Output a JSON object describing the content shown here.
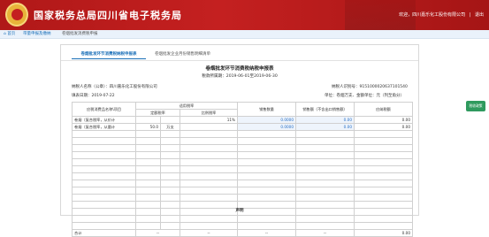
{
  "header": {
    "title": "国家税务总局四川省电子税务局",
    "welcome": "欢迎，四川嘉乐化工股份有限公司",
    "logout": "退出"
  },
  "nav": {
    "home": "首页",
    "crumb1": "带量申报及缴纳",
    "crumb2": "卷烟批发消费税申报"
  },
  "tabs": {
    "active": "卷烟批发环节消费税纳税申报表",
    "inactive": "卷烟批发企业月份销售明细清单"
  },
  "form": {
    "title": "卷烟批发环节消费税纳税申报表",
    "period": "税款所属期：2019-06-01至2019-06-30",
    "taxpayer_label": "纳税人名称（公章）：",
    "taxpayer_name": "四川嘉乐化工股份有限公司",
    "tax_id_label": "纳税人识别号：",
    "tax_id": "9151000020637101540",
    "fill_date_label": "填表日期：",
    "fill_date": "2019-07-22",
    "units": "单位：卷烟万支、金额单位：元（列至角分）"
  },
  "table": {
    "headers": {
      "product": "应税消费品名称\\项目",
      "rate": "适用税率",
      "fixed": "定额税率",
      "percent": "比例税率",
      "quantity": "销售数量",
      "sales": "销售额（不含出口销售额）",
      "tax": "应纳税额"
    },
    "rows": [
      {
        "name": "卷烟（复合税率，从价计",
        "fixed": "",
        "unit": "",
        "percent": "11%",
        "quantity": "0.0000",
        "sales": "0.00",
        "tax": "0.00"
      },
      {
        "name": "卷烟（复合税率，从量计",
        "fixed": "50.0",
        "unit": "万支",
        "percent": "",
        "quantity": "0.0000",
        "sales": "0.00",
        "tax": "0.00"
      }
    ],
    "total_label": "合计",
    "total_fixed": "--",
    "total_percent": "--",
    "total_quantity": "--",
    "total_sales": "--",
    "total_tax": "0.00"
  },
  "declaration": "声明",
  "side_button": "税收政策"
}
